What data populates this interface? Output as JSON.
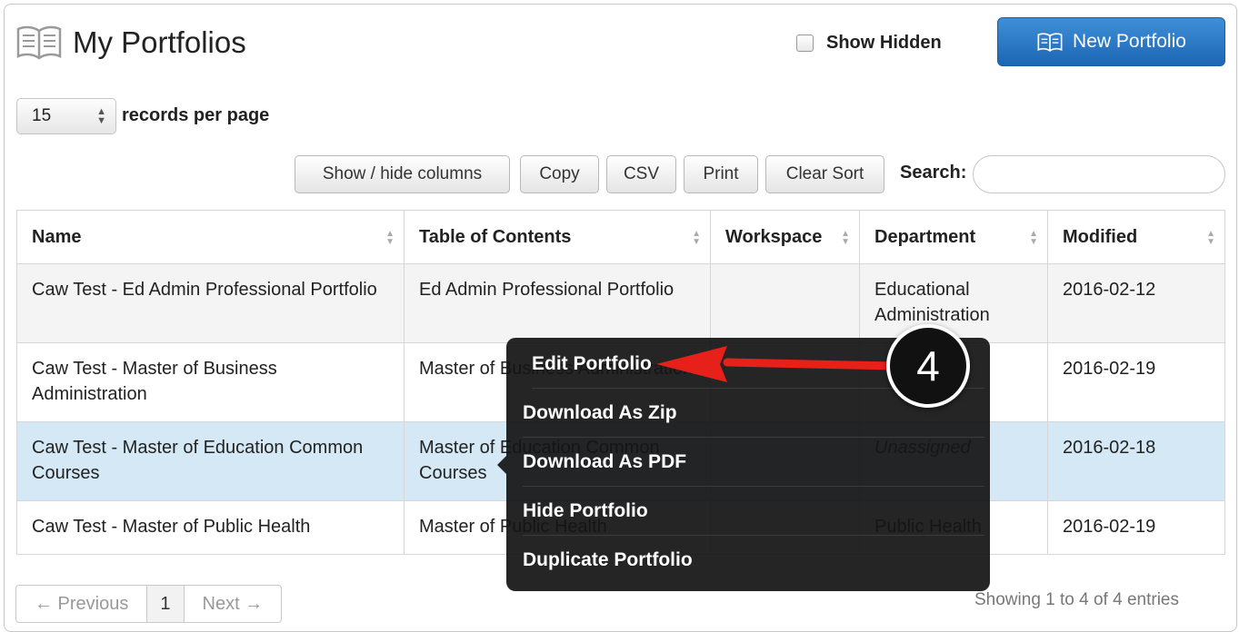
{
  "header": {
    "title": "My Portfolios",
    "show_hidden_label": "Show Hidden",
    "new_button_label": "New Portfolio"
  },
  "records": {
    "page_size": "15",
    "label": "records per page"
  },
  "toolbar": {
    "show_hide_columns": "Show / hide columns",
    "copy": "Copy",
    "csv": "CSV",
    "print": "Print",
    "clear_sort": "Clear Sort",
    "search_label": "Search:",
    "search_value": ""
  },
  "table": {
    "columns": [
      "Name",
      "Table of Contents",
      "Workspace",
      "Department",
      "Modified"
    ],
    "rows": [
      {
        "name": "Caw Test - Ed Admin Professional Portfolio",
        "toc": "Ed Admin Professional Portfolio",
        "workspace": "",
        "department": "Educational Administration",
        "modified": "2016-02-12"
      },
      {
        "name": "Caw Test - Master of Business Administration",
        "toc": "Master of Business Administration",
        "workspace": "",
        "department": "",
        "modified": "2016-02-19"
      },
      {
        "name": "Caw Test - Master of Education Common Courses",
        "toc": "Master of Education Common Courses",
        "workspace": "",
        "department": "Unassigned",
        "modified": "2016-02-18"
      },
      {
        "name": "Caw Test - Master of Public Health",
        "toc": "Master of Public Health",
        "workspace": "",
        "department": "Public Health",
        "modified": "2016-02-19"
      }
    ]
  },
  "context_menu": {
    "items": [
      "Edit Portfolio",
      "Download As Zip",
      "Download As PDF",
      "Hide Portfolio",
      "Duplicate Portfolio"
    ]
  },
  "annotation": {
    "step_number": "4",
    "arrow_color": "#e8201a"
  },
  "pagination": {
    "previous": "← Previous",
    "current": "1",
    "next": "Next →",
    "info": "Showing 1 to 4 of 4 entries"
  },
  "colors": {
    "primary_button": "#2a78c6",
    "selected_row": "#d4e9f5",
    "menu_background": "#141414"
  }
}
